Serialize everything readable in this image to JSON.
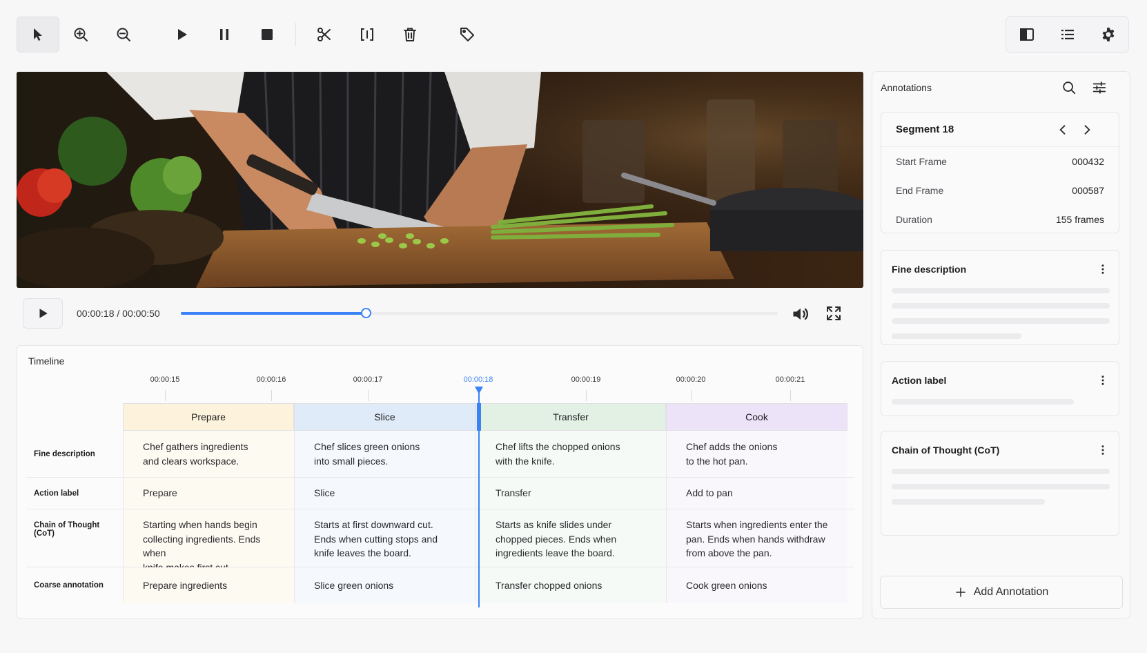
{
  "toolbar": {
    "tools": [
      "select-pointer-icon",
      "zoom-in-icon",
      "zoom-out-icon",
      "play-icon",
      "pause-icon",
      "stop-icon",
      "scissors-icon",
      "split-bracket-icon",
      "trash-icon",
      "tag-icon"
    ],
    "right_tools": [
      "panel-layout-icon",
      "list-icon",
      "gear-icon"
    ]
  },
  "player": {
    "time": "00:00:18 / 00:00:50",
    "progress": 0.31,
    "icons": [
      "play-icon",
      "volume-icon",
      "fullscreen-icon"
    ]
  },
  "timeline": {
    "title": "Timeline",
    "current_time": "00:00:18",
    "ticks": [
      "00:00:15",
      "00:00:16",
      "00:00:17",
      "00:00:18",
      "00:00:19",
      "00:00:20",
      "00:00:21"
    ],
    "segments": [
      {
        "label": "Prepare",
        "color": "#fdf3dc"
      },
      {
        "label": "Slice",
        "color": "#e0ebf9"
      },
      {
        "label": "Transfer",
        "color": "#e3f1e5"
      },
      {
        "label": "Cook",
        "color": "#ece3f8"
      }
    ],
    "rows": [
      {
        "label": "Fine description",
        "cells": [
          "Chef gathers ingredients\nand clears workspace.",
          "Chef slices green onions\ninto small pieces.",
          "Chef lifts the chopped onions\nwith the knife.",
          "Chef adds the onions\nto the hot pan."
        ]
      },
      {
        "label": "Action label",
        "cells": [
          "Prepare",
          "Slice",
          "Transfer",
          "Add to pan"
        ]
      },
      {
        "label": "Chain of Thought (CoT)",
        "cells": [
          "Starting when hands begin\ncollecting ingredients. Ends when\nknife makes first cut.",
          "Starts at first downward cut.\nEnds when cutting stops and\nknife leaves the board.",
          "Starts as knife slides under\nchopped pieces. Ends when\ningredients leave the board.",
          "Starts when ingredients enter the\npan. Ends when hands withdraw\nfrom above the pan."
        ]
      },
      {
        "label": "Coarse annotation",
        "cells": [
          "Prepare ingredients",
          "Slice green onions",
          "Transfer chopped onions",
          "Cook green onions"
        ]
      }
    ]
  },
  "annotations": {
    "title": "Annotations",
    "segment": {
      "name": "Segment 18",
      "fields": [
        {
          "key": "Start Frame",
          "value": "000432"
        },
        {
          "key": "End Frame",
          "value": "000587"
        },
        {
          "key": "Duration",
          "value": "155 frames"
        }
      ]
    },
    "cards": [
      "Fine description",
      "Action label",
      "Chain of Thought (CoT)"
    ],
    "add_label": "Add Annotation"
  },
  "colors": {
    "accent": "#3b82f6"
  }
}
